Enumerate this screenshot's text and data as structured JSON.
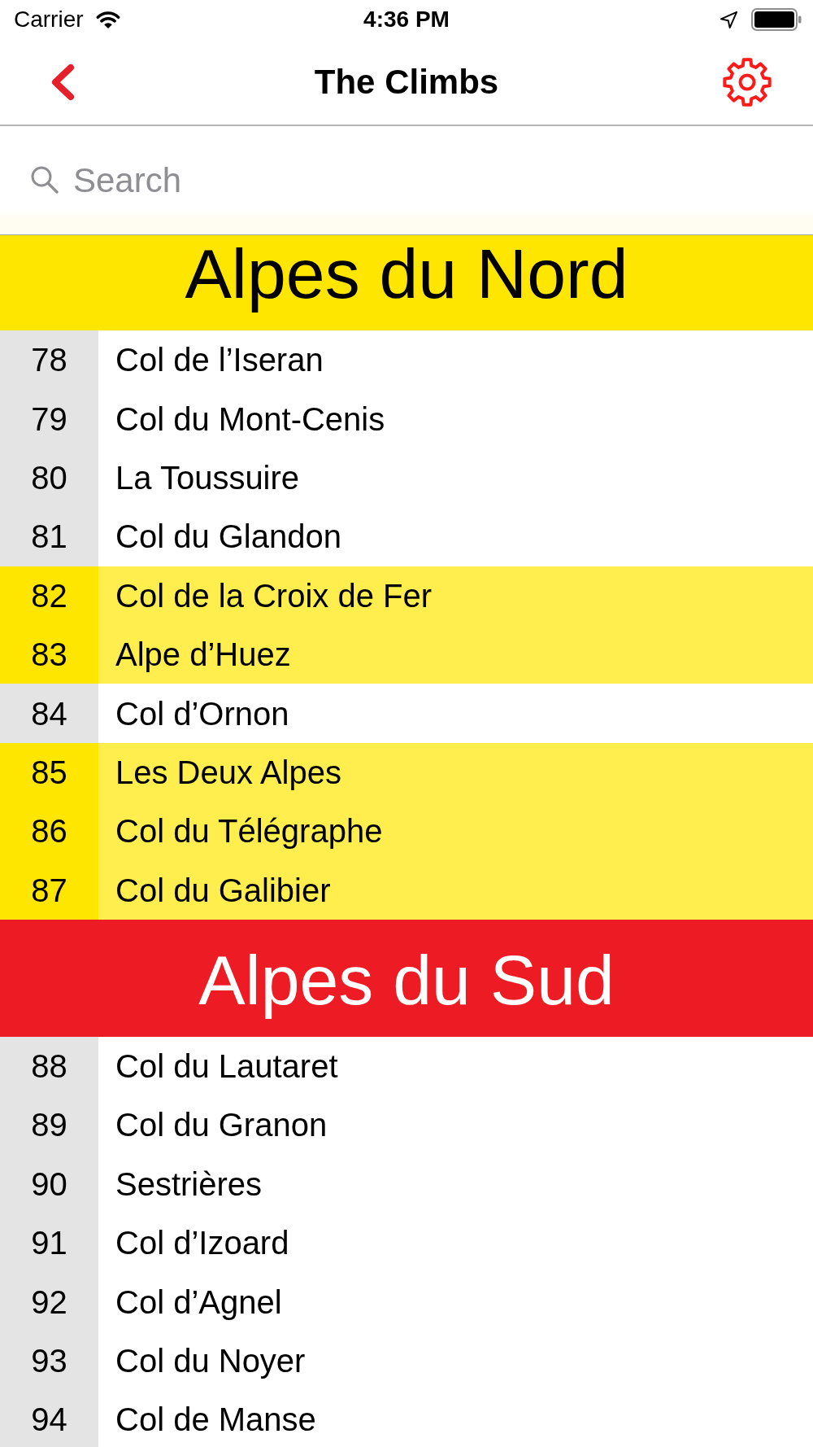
{
  "status_bar": {
    "carrier": "Carrier",
    "time": "4:36 PM"
  },
  "nav_bar": {
    "title": "The Climbs"
  },
  "search": {
    "placeholder": "Search"
  },
  "sections": [
    {
      "title": "Alpes du Nord",
      "color": "#ffe600",
      "climbs": [
        {
          "number": "78",
          "name": "Col de l’Iseran",
          "highlighted": false
        },
        {
          "number": "79",
          "name": "Col du Mont-Cenis",
          "highlighted": false
        },
        {
          "number": "80",
          "name": "La Toussuire",
          "highlighted": false
        },
        {
          "number": "81",
          "name": "Col du Glandon",
          "highlighted": false
        },
        {
          "number": "82",
          "name": "Col de la Croix de Fer",
          "highlighted": true
        },
        {
          "number": "83",
          "name": "Alpe d’Huez",
          "highlighted": true
        },
        {
          "number": "84",
          "name": "Col d’Ornon",
          "highlighted": false
        },
        {
          "number": "85",
          "name": "Les Deux Alpes",
          "highlighted": true
        },
        {
          "number": "86",
          "name": "Col du Télégraphe",
          "highlighted": true
        },
        {
          "number": "87",
          "name": "Col du Galibier",
          "highlighted": true
        }
      ]
    },
    {
      "title": "Alpes du Sud",
      "color": "#ed1c24",
      "climbs": [
        {
          "number": "88",
          "name": "Col du Lautaret",
          "highlighted": false
        },
        {
          "number": "89",
          "name": "Col du Granon",
          "highlighted": false
        },
        {
          "number": "90",
          "name": "Sestrières",
          "highlighted": false
        },
        {
          "number": "91",
          "name": "Col d’Izoard",
          "highlighted": false
        },
        {
          "number": "92",
          "name": "Col d’Agnel",
          "highlighted": false
        },
        {
          "number": "93",
          "name": "Col du Noyer",
          "highlighted": false
        },
        {
          "number": "94",
          "name": "Col de Manse",
          "highlighted": false
        }
      ]
    }
  ]
}
